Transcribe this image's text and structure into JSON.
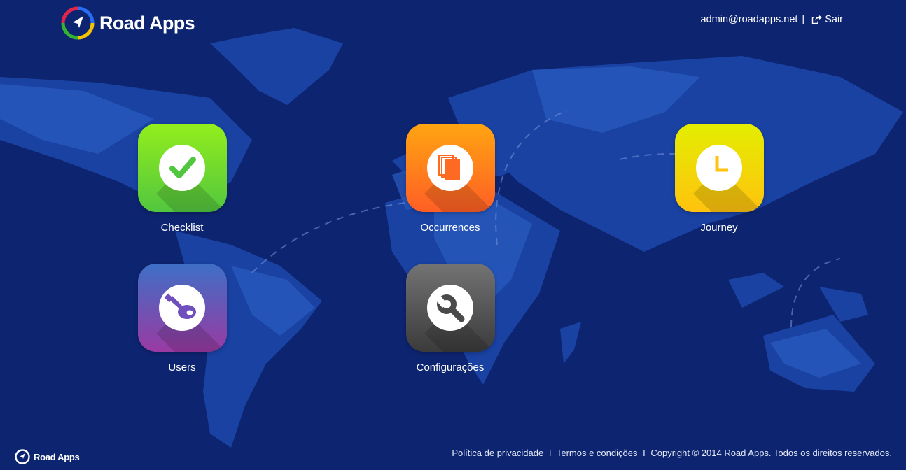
{
  "brand": {
    "name": "Road Apps",
    "logo_colors": [
      "#2a6df4",
      "#f5c400",
      "#34b233",
      "#e4254b"
    ]
  },
  "header": {
    "user_email": "admin@roadapps.net",
    "separator": "|",
    "logout_label": "Sair"
  },
  "apps": [
    {
      "label": "Checklist",
      "icon": "checkmark-icon",
      "gradient": [
        "#93ee1c",
        "#52c63f"
      ]
    },
    {
      "label": "Occurrences",
      "icon": "documents-icon",
      "gradient": [
        "#ffa511",
        "#ff5e25"
      ]
    },
    {
      "label": "Journey",
      "icon": "clock-icon",
      "gradient": [
        "#e3ee00",
        "#ffc20e"
      ]
    },
    {
      "label": "Users",
      "icon": "key-icon",
      "gradient": [
        "#3e6fc6",
        "#9a3aa2"
      ]
    },
    {
      "label": "Configurações",
      "icon": "wrench-icon",
      "gradient": [
        "#737373",
        "#3b3b3b"
      ]
    }
  ],
  "footer": {
    "privacy": "Política de privacidade",
    "terms": "Termos e condições",
    "copyright": "Copyright © 2014 Road Apps. Todos os direitos reservados.",
    "separator": "I"
  },
  "colors": {
    "background": "#0d2470",
    "continent_light": "#2b5cc0",
    "continent_dark": "#1a3d9e"
  }
}
